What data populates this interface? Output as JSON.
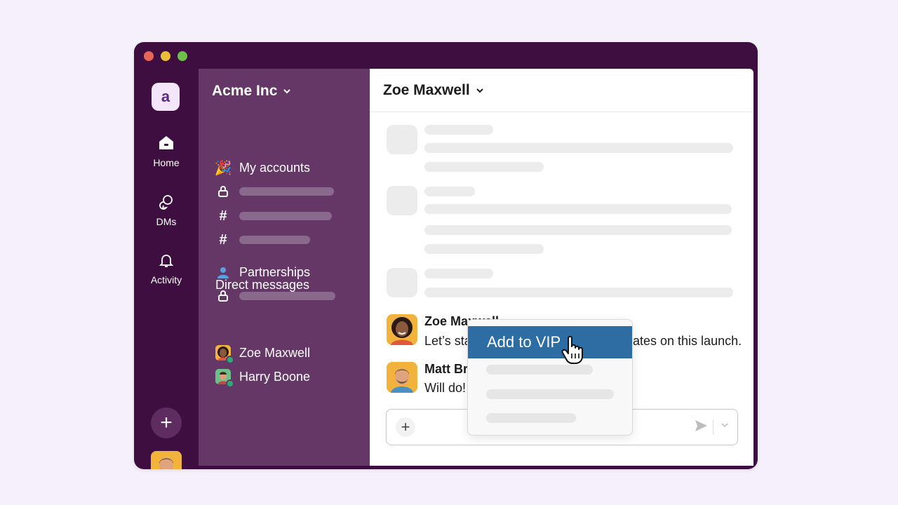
{
  "window": {
    "controls": [
      "close",
      "minimize",
      "maximize"
    ]
  },
  "rail": {
    "workspace_initial": "a",
    "items": [
      {
        "label": "Home",
        "icon": "home-icon"
      },
      {
        "label": "DMs",
        "icon": "dms-icon"
      },
      {
        "label": "Activity",
        "icon": "bell-icon"
      }
    ],
    "add_label": "+"
  },
  "sidebar": {
    "workspace_name": "Acme Inc",
    "items": [
      {
        "label": "My accounts",
        "icon": "party-popper-icon"
      },
      {
        "label": "Partnerships",
        "icon": "people-icon"
      }
    ],
    "dm_heading": "Direct messages",
    "dms": [
      {
        "name": "Zoe Maxwell"
      },
      {
        "name": "Harry Boone"
      }
    ]
  },
  "main": {
    "channel_title": "Zoe Maxwell",
    "messages": [
      {
        "author": "Zoe Maxwell",
        "text": "Let’s sta",
        "text_tail": "ates on this launch."
      },
      {
        "author": "Matt Br",
        "text": "Will do!"
      }
    ],
    "composer": {
      "plus": "+"
    }
  },
  "context_menu": {
    "active_item": "Add to VIP"
  },
  "colors": {
    "window_bg": "#3f0e40",
    "sidebar_bg": "#643766",
    "menu_highlight": "#2e6da4",
    "presence": "#2bac76"
  }
}
